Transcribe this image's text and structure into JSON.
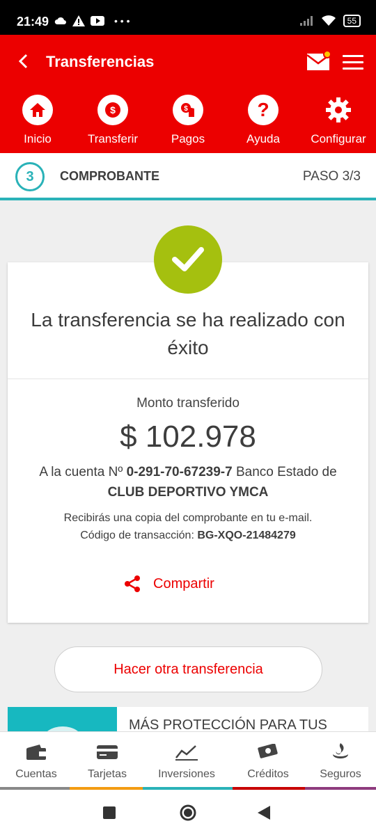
{
  "status": {
    "time": "21:49",
    "battery": "55"
  },
  "header": {
    "title": "Transferencias"
  },
  "quick": [
    {
      "label": "Inicio"
    },
    {
      "label": "Transferir"
    },
    {
      "label": "Pagos"
    },
    {
      "label": "Ayuda"
    },
    {
      "label": "Configurar"
    }
  ],
  "step": {
    "number": "3",
    "label": "COMPROBANTE",
    "count": "PASO 3/3"
  },
  "receipt": {
    "success": "La transferencia se ha realizado con éxito",
    "amount_label": "Monto transferido",
    "amount": "$ 102.978",
    "account_prefix": "A la cuenta Nº",
    "account_number": "0-291-70-67239-7",
    "bank": "Banco Estado de",
    "beneficiary": "CLUB DEPORTIVO YMCA",
    "copy_notice": "Recibirás una copia del comprobante en tu e-mail.",
    "tx_label": "Código de transacción:",
    "tx_code": "BG-XQO-21484279",
    "share_label": "Compartir"
  },
  "another_button": "Hacer otra transferencia",
  "promo": {
    "text": "MÁS PROTECCIÓN PARA TUS"
  },
  "tabs": [
    {
      "label": "Cuentas",
      "color": "#888888"
    },
    {
      "label": "Tarjetas",
      "color": "#f39c12"
    },
    {
      "label": "Inversiones",
      "color": "#2ab2b8"
    },
    {
      "label": "Créditos",
      "color": "#c80000"
    },
    {
      "label": "Seguros",
      "color": "#8e3b7e"
    }
  ],
  "colors": {
    "brand": "#ec0000",
    "accent": "#2ab2b8",
    "success": "#a5c00f"
  }
}
